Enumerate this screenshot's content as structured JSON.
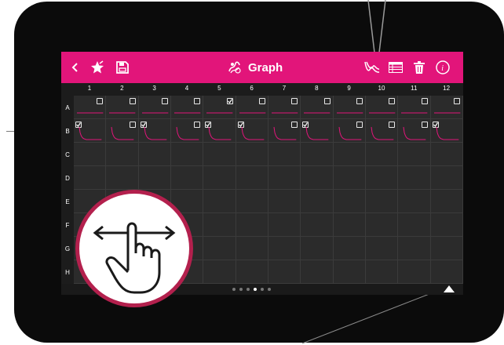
{
  "toolbar": {
    "title": "Graph",
    "accent": "#e2157a",
    "left_icons": [
      "back-icon",
      "star-icon",
      "save-icon"
    ],
    "right_icons": [
      "graph-lines-icon",
      "table-icon",
      "trash-icon",
      "info-icon"
    ]
  },
  "grid": {
    "columns": [
      "1",
      "2",
      "3",
      "4",
      "5",
      "6",
      "7",
      "8",
      "9",
      "10",
      "11",
      "12"
    ],
    "rows": [
      "A",
      "B",
      "C",
      "D",
      "E",
      "F",
      "G",
      "H"
    ],
    "row_a_checked": [
      false,
      false,
      false,
      false,
      true,
      false,
      false,
      false,
      false,
      false,
      false,
      false
    ],
    "row_b_checked": [
      true,
      false,
      true,
      false,
      true,
      true,
      false,
      true,
      false,
      false,
      false,
      true
    ]
  },
  "pager": {
    "page_count": 6,
    "active_page": 4
  },
  "gesture": {
    "icon": "swipe-horizontal-hand-icon"
  }
}
